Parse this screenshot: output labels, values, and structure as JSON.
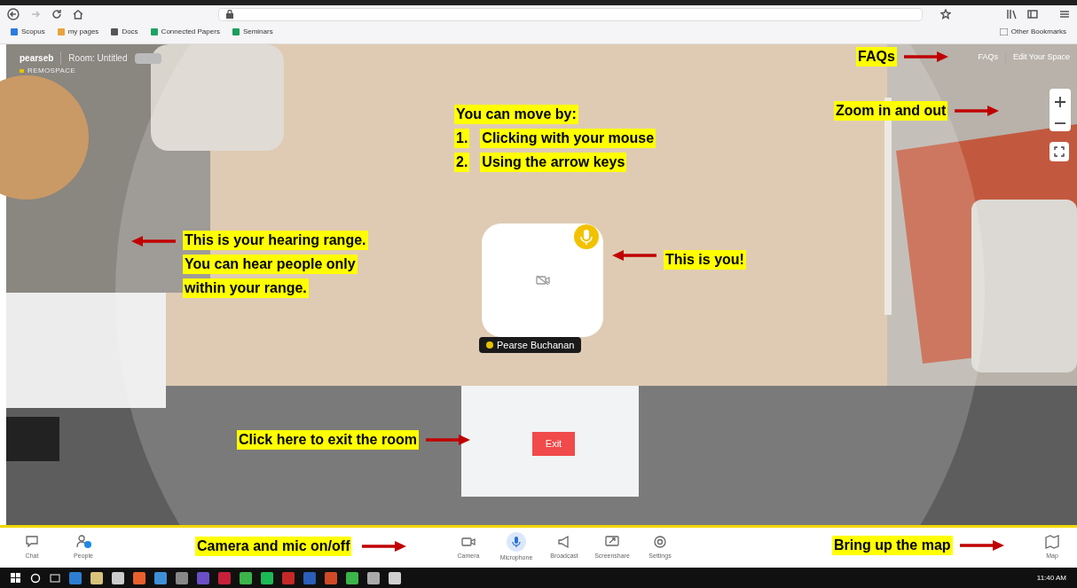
{
  "browser": {
    "bookmarks": [
      {
        "label": "Scopus"
      },
      {
        "label": "my pages"
      },
      {
        "label": "Docs"
      },
      {
        "label": "Connected Papers"
      },
      {
        "label": "Seminars"
      }
    ],
    "other_bookmarks": "Other Bookmarks"
  },
  "room": {
    "user": "pearseb",
    "room_name": "Room: Untitled",
    "brand": "REMOSPACE"
  },
  "top_links": [
    "FAQs",
    "Edit Your Space"
  ],
  "avatar": {
    "name": "Pearse Buchanan",
    "mic_on": true
  },
  "exit_button": "Exit",
  "annotations": [
    {
      "lines": [
        "FAQs"
      ],
      "kind": "right"
    },
    {
      "lines": [
        "Zoom in and out"
      ],
      "kind": "right"
    },
    {
      "lines": [
        "You can move by:"
      ],
      "steps": [
        {
          "number": "1.",
          "text": "Clicking with your mouse"
        },
        {
          "number": "2.",
          "text": "Using the arrow keys"
        }
      ],
      "kind": "plain"
    },
    {
      "lines": [
        "This is your hearing range.",
        "You can hear people only",
        "within your range."
      ],
      "kind": "left"
    },
    {
      "lines": [
        "This is you!"
      ],
      "kind": "left"
    },
    {
      "lines": [
        "Click here to exit the room"
      ],
      "kind": "right"
    },
    {
      "lines": [
        "Camera and mic on/off"
      ],
      "kind": "right"
    },
    {
      "lines": [
        "Bring up the map"
      ],
      "kind": "right"
    }
  ],
  "toolbar": [
    {
      "label": "Chat",
      "kind": "left",
      "selected": false
    },
    {
      "label": "People",
      "kind": "left",
      "selected": false
    },
    {
      "label": "Camera",
      "kind": "center",
      "selected": false
    },
    {
      "label": "Microphone",
      "kind": "center",
      "selected": true
    },
    {
      "label": "Broadcast",
      "kind": "center",
      "selected": false
    },
    {
      "label": "Screenshare",
      "kind": "center",
      "selected": false
    },
    {
      "label": "Settings",
      "kind": "center",
      "selected": false
    },
    {
      "label": "Map",
      "kind": "right",
      "selected": false
    }
  ],
  "taskbar": {
    "time": "11:40 AM"
  }
}
